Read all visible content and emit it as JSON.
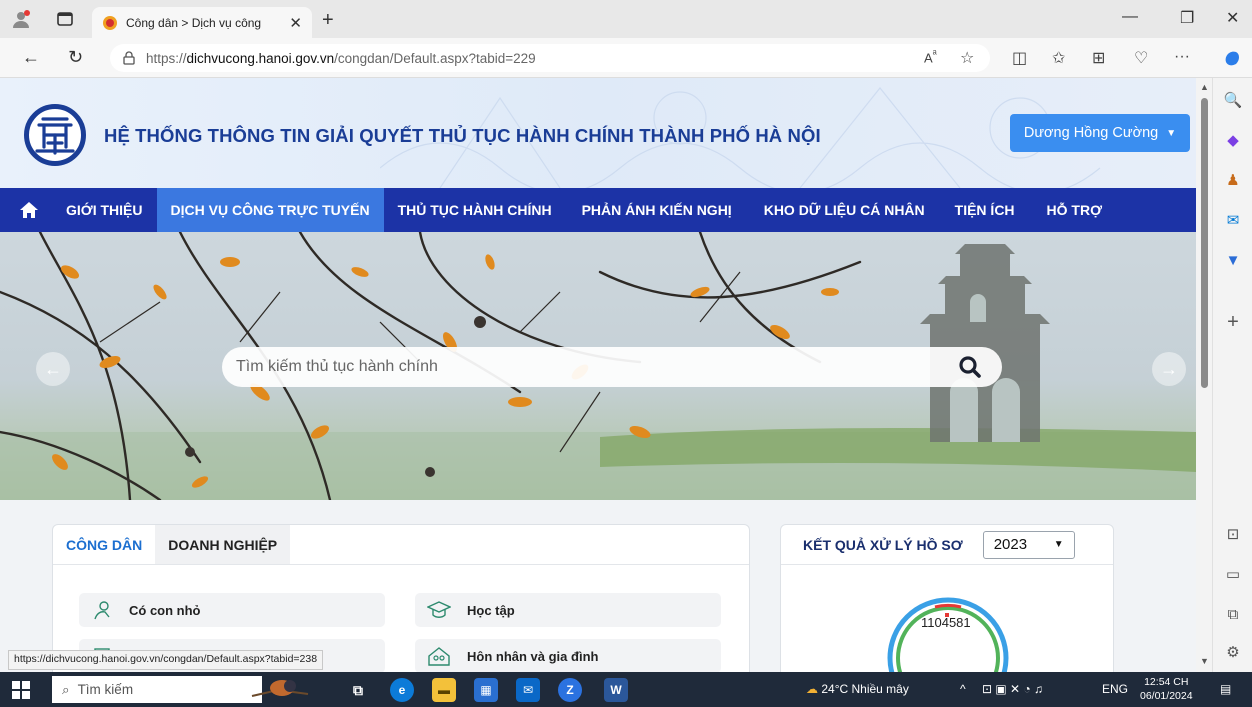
{
  "browser": {
    "tab_title": "Công dân > Dịch vụ công",
    "url_prefix": "https://",
    "url_domain": "dichvucong.hanoi.gov.vn",
    "url_path": "/congdan/Default.aspx?tabid=229",
    "status_url": "https://dichvucong.hanoi.gov.vn/congdan/Default.aspx?tabid=238"
  },
  "header": {
    "site_title": "HỆ THỐNG THÔNG TIN GIẢI QUYẾT THỦ TỤC HÀNH CHÍNH THÀNH PHỐ HÀ NỘI",
    "user_name": "Dương Hồng Cường"
  },
  "nav": {
    "items": [
      {
        "label": "GIỚI THIỆU"
      },
      {
        "label": "DỊCH VỤ CÔNG TRỰC TUYẾN"
      },
      {
        "label": "THỦ TỤC HÀNH CHÍNH"
      },
      {
        "label": "PHẢN ÁNH KIẾN NGHỊ"
      },
      {
        "label": "KHO DỮ LIỆU CÁ NHÂN"
      },
      {
        "label": "TIỆN ÍCH"
      },
      {
        "label": "HỖ TRỢ"
      }
    ]
  },
  "search": {
    "placeholder": "Tìm kiếm thủ tục hành chính"
  },
  "services": {
    "tabs": [
      {
        "label": "CÔNG DÂN"
      },
      {
        "label": "DOANH NGHIỆP"
      }
    ],
    "items": [
      {
        "label": "Có con nhỏ"
      },
      {
        "label": "Học tập"
      },
      {
        "label": "Hôn nhân và gia đình"
      }
    ]
  },
  "stats": {
    "title": "KẾT QUẢ XỬ LÝ HỒ SƠ",
    "year": "2023",
    "total": "1104581"
  },
  "taskbar": {
    "search_label": "Tìm kiếm",
    "weather": "24°C  Nhiều mây",
    "lang": "ENG",
    "time": "12:54 CH",
    "date": "06/01/2024"
  },
  "colors": {
    "nav_bg": "#1c33a6",
    "nav_active": "#3b78e0",
    "title_blue": "#1a3d96",
    "user_button": "#3a8ef0"
  }
}
